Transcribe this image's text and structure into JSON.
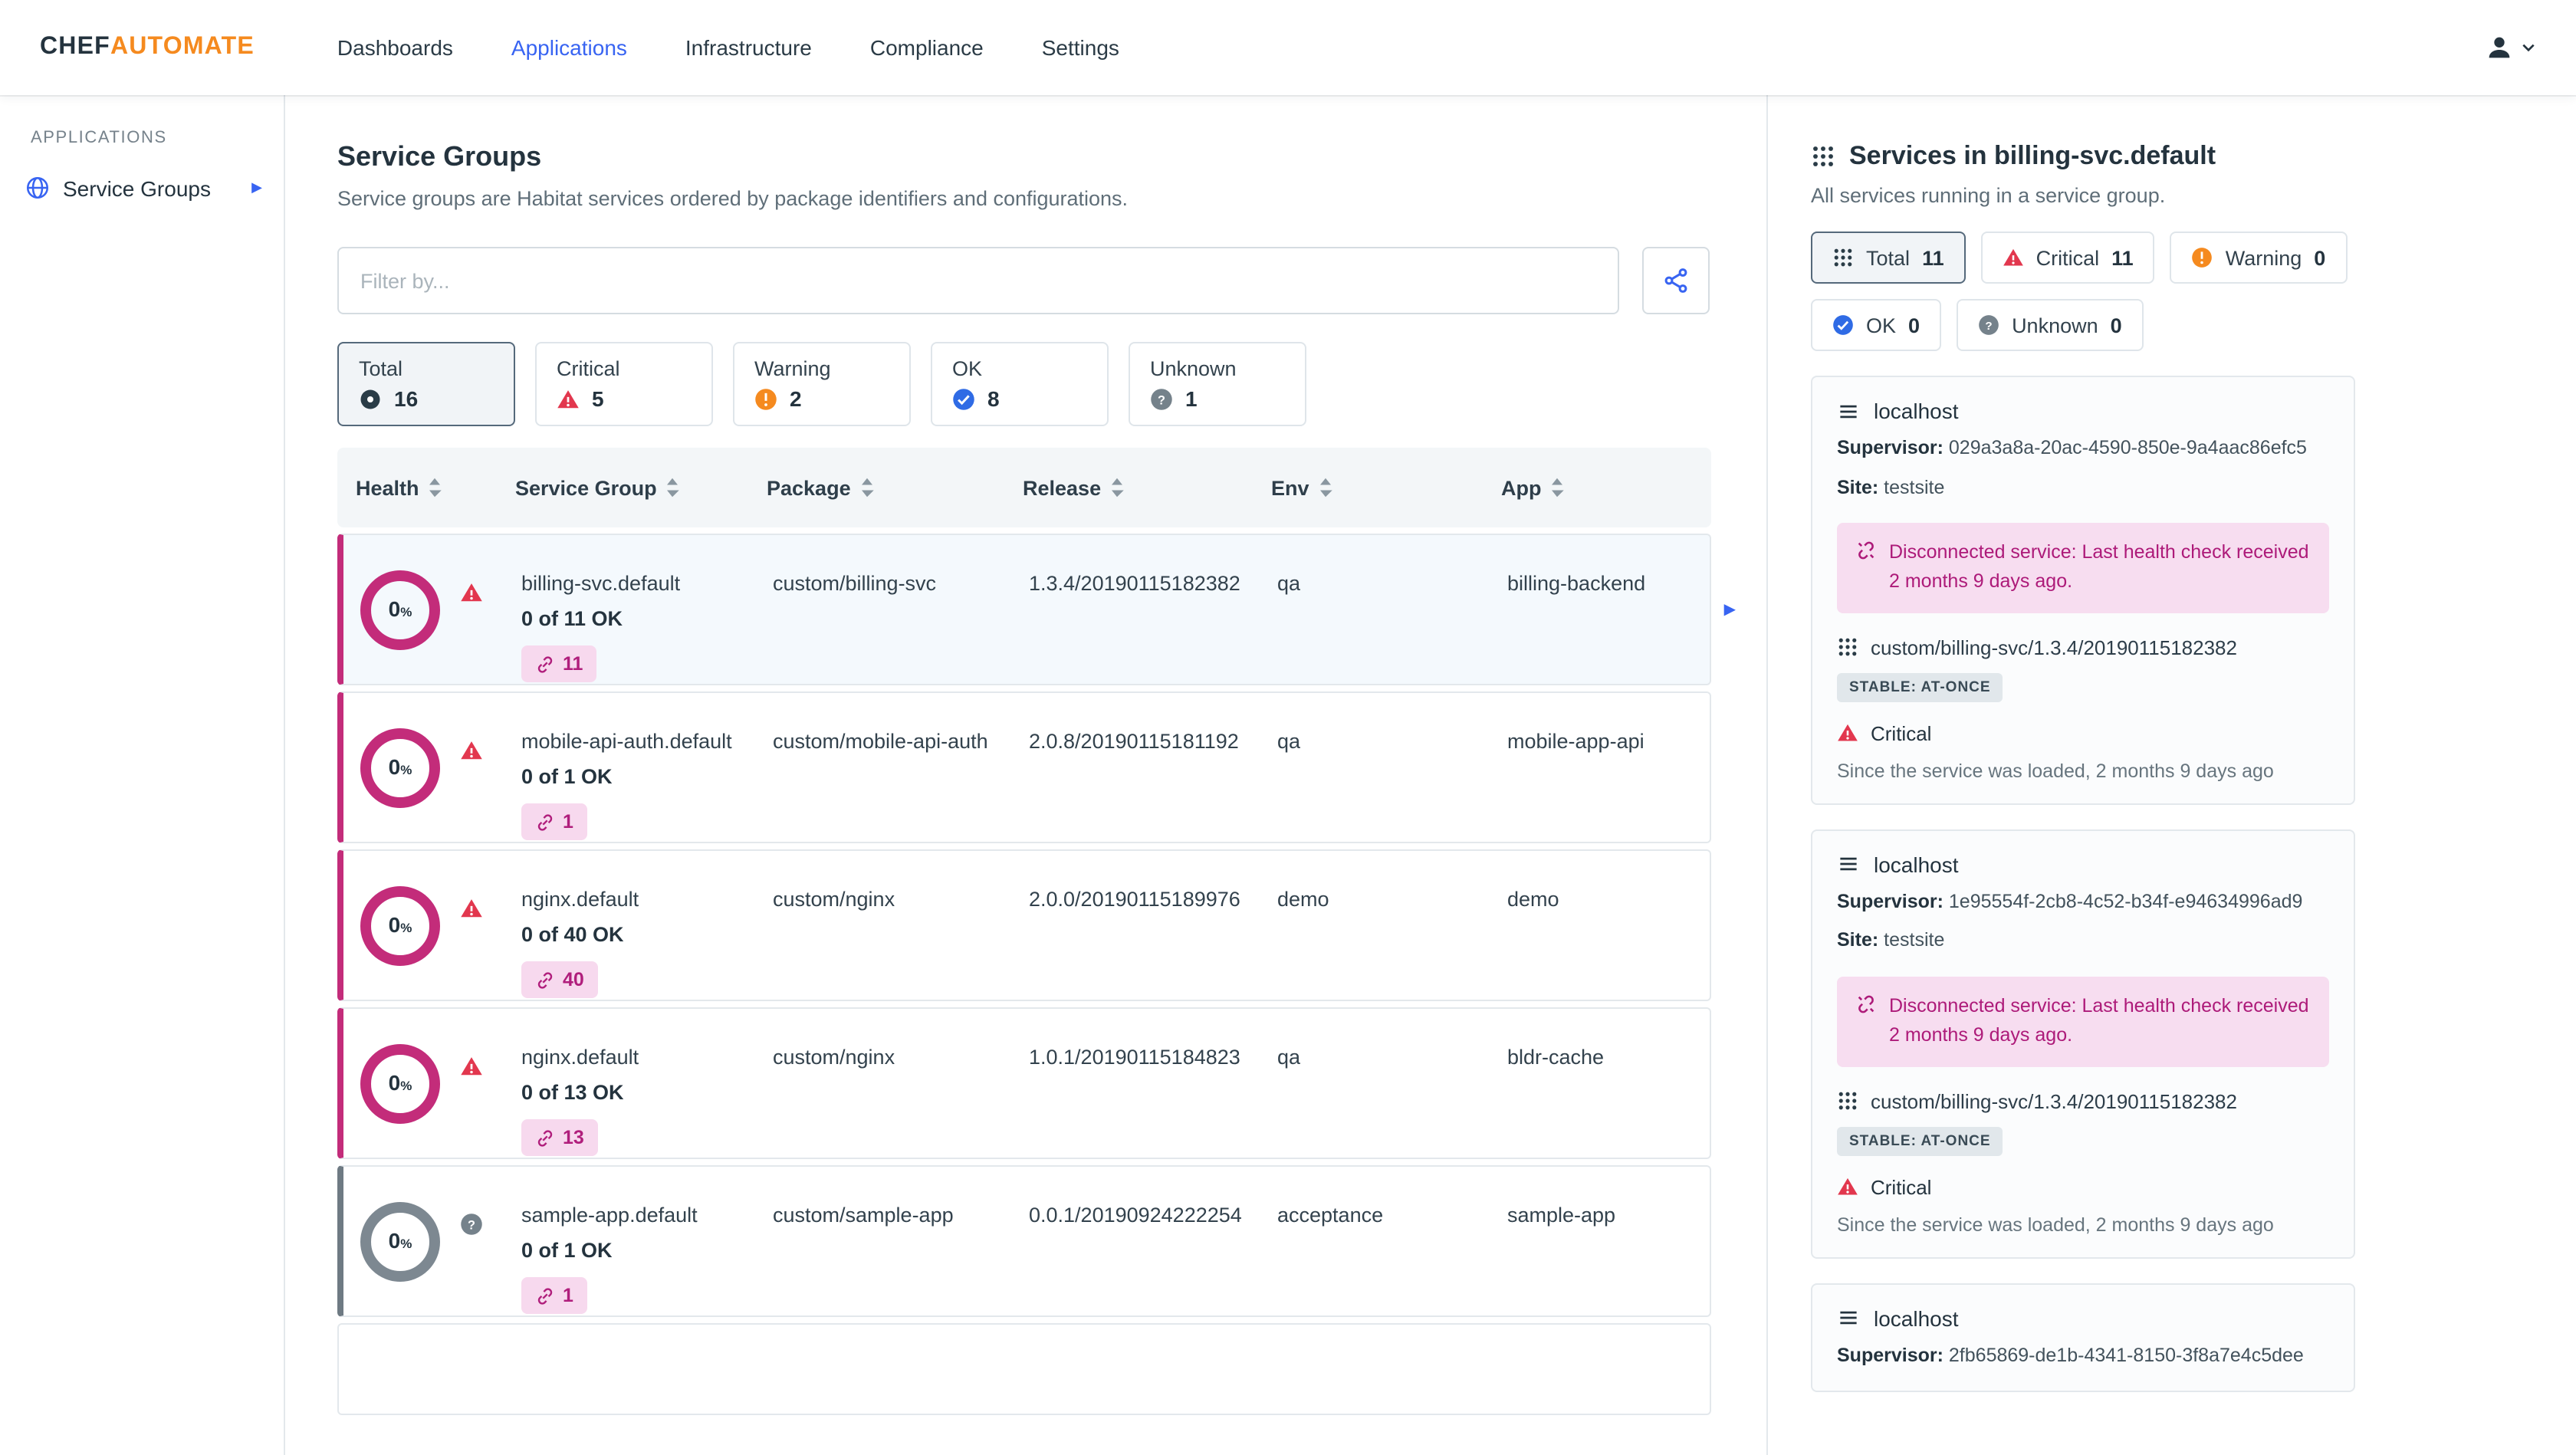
{
  "brand": {
    "chef": "CHEF",
    "automate": "AUTOMATE"
  },
  "nav": {
    "items": [
      {
        "label": "Dashboards"
      },
      {
        "label": "Applications"
      },
      {
        "label": "Infrastructure"
      },
      {
        "label": "Compliance"
      },
      {
        "label": "Settings"
      }
    ]
  },
  "sidebar": {
    "heading": "APPLICATIONS",
    "item": {
      "label": "Service Groups"
    }
  },
  "main": {
    "title": "Service Groups",
    "subtitle": "Service groups are Habitat services ordered by package identifiers and configurations.",
    "filter": {
      "placeholder": "Filter by..."
    },
    "status_filters": [
      {
        "label": "Total",
        "count": "16"
      },
      {
        "label": "Critical",
        "count": "5"
      },
      {
        "label": "Warning",
        "count": "2"
      },
      {
        "label": "OK",
        "count": "8"
      },
      {
        "label": "Unknown",
        "count": "1"
      }
    ],
    "table": {
      "columns": [
        "Health",
        "Service Group",
        "Package",
        "Release",
        "Env",
        "App"
      ],
      "health_unit": "%",
      "rows": [
        {
          "health": "0",
          "status": "critical",
          "name": "billing-svc.default",
          "ok": "0 of 11 OK",
          "badge": "11",
          "package": "custom/billing-svc",
          "release": "1.3.4/20190115182382",
          "env": "qa",
          "app": "billing-backend"
        },
        {
          "health": "0",
          "status": "critical",
          "name": "mobile-api-auth.default",
          "ok": "0 of 1 OK",
          "badge": "1",
          "package": "custom/mobile-api-auth",
          "release": "2.0.8/20190115181192",
          "env": "qa",
          "app": "mobile-app-api"
        },
        {
          "health": "0",
          "status": "critical",
          "name": "nginx.default",
          "ok": "0 of 40 OK",
          "badge": "40",
          "package": "custom/nginx",
          "release": "2.0.0/20190115189976",
          "env": "demo",
          "app": "demo"
        },
        {
          "health": "0",
          "status": "critical",
          "name": "nginx.default",
          "ok": "0 of 13 OK",
          "badge": "13",
          "package": "custom/nginx",
          "release": "1.0.1/20190115184823",
          "env": "qa",
          "app": "bldr-cache"
        },
        {
          "health": "0",
          "status": "unknown",
          "name": "sample-app.default",
          "ok": "0 of 1 OK",
          "badge": "1",
          "package": "custom/sample-app",
          "release": "0.0.1/20190924222254",
          "env": "acceptance",
          "app": "sample-app"
        }
      ]
    }
  },
  "panel": {
    "title": "Services in billing-svc.default",
    "subtitle": "All services running in a service group.",
    "chips": [
      {
        "label": "Total",
        "count": "11"
      },
      {
        "label": "Critical",
        "count": "11"
      },
      {
        "label": "Warning",
        "count": "0"
      },
      {
        "label": "OK",
        "count": "0"
      },
      {
        "label": "Unknown",
        "count": "0"
      }
    ],
    "labels": {
      "supervisor": "Supervisor:",
      "site": "Site:"
    },
    "cards": [
      {
        "host": "localhost",
        "supervisor": "029a3a8a-20ac-4590-850e-9a4aac86efc5",
        "site": "testsite",
        "alert": "Disconnected service: Last health check received 2 months 9 days ago.",
        "package": "custom/billing-svc/1.3.4/20190115182382",
        "badge": "STABLE: AT-ONCE",
        "status": "Critical",
        "since": "Since the service was loaded, 2 months 9 days ago"
      },
      {
        "host": "localhost",
        "supervisor": "1e95554f-2cb8-4c52-b34f-e94634996ad9",
        "site": "testsite",
        "alert": "Disconnected service: Last health check received 2 months 9 days ago.",
        "package": "custom/billing-svc/1.3.4/20190115182382",
        "badge": "STABLE: AT-ONCE",
        "status": "Critical",
        "since": "Since the service was loaded, 2 months 9 days ago"
      },
      {
        "host": "localhost",
        "supervisor": "2fb65869-de1b-4341-8150-3f8a7e4c5dee"
      }
    ]
  },
  "colors": {
    "accent_blue": "#3864f2",
    "brand_orange": "#f58a1f",
    "critical_red": "#e2374e",
    "health_pink": "#c32c7a",
    "warning_orange": "#f58a1f",
    "ok_blue": "#2f6be5",
    "unknown_gray": "#75828b"
  }
}
